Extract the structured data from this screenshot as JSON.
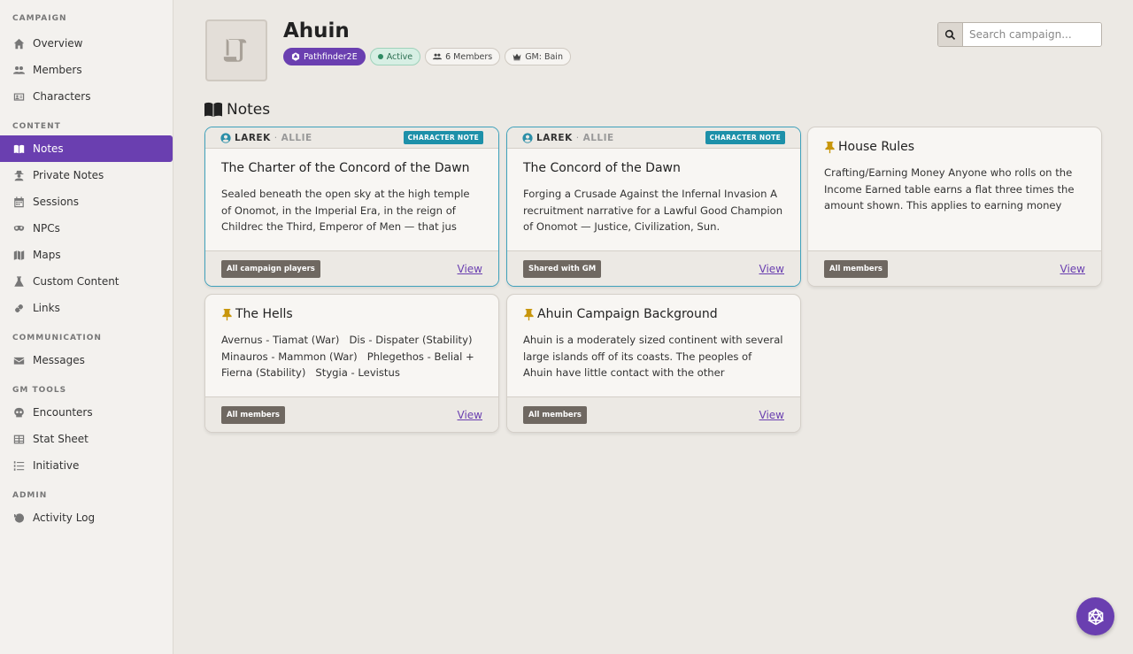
{
  "sidebar": {
    "sections": [
      {
        "label": "CAMPAIGN",
        "items": [
          {
            "label": "Overview",
            "icon": "home-icon"
          },
          {
            "label": "Members",
            "icon": "users-icon"
          },
          {
            "label": "Characters",
            "icon": "id-card-icon"
          }
        ]
      },
      {
        "label": "CONTENT",
        "items": [
          {
            "label": "Notes",
            "icon": "book-icon",
            "active": true
          },
          {
            "label": "Private Notes",
            "icon": "user-secret-icon"
          },
          {
            "label": "Sessions",
            "icon": "calendar-icon"
          },
          {
            "label": "NPCs",
            "icon": "mask-icon"
          },
          {
            "label": "Maps",
            "icon": "map-icon"
          },
          {
            "label": "Custom Content",
            "icon": "flask-icon"
          },
          {
            "label": "Links",
            "icon": "link-icon"
          }
        ]
      },
      {
        "label": "COMMUNICATION",
        "items": [
          {
            "label": "Messages",
            "icon": "envelope-icon"
          }
        ]
      },
      {
        "label": "GM TOOLS",
        "items": [
          {
            "label": "Encounters",
            "icon": "skull-icon"
          },
          {
            "label": "Stat Sheet",
            "icon": "table-icon"
          },
          {
            "label": "Initiative",
            "icon": "list-ordered-icon"
          }
        ]
      },
      {
        "label": "ADMIN",
        "items": [
          {
            "label": "Activity Log",
            "icon": "history-icon"
          }
        ]
      }
    ]
  },
  "campaign": {
    "title": "Ahuin",
    "system": "Pathfinder2E",
    "status": "Active",
    "members": "6 Members",
    "gm": "GM: Bain"
  },
  "search": {
    "placeholder": "Search campaign..."
  },
  "notes_heading": "Notes",
  "notes": [
    {
      "type": "character",
      "owner": "LAREK",
      "player": "ALLIE",
      "tag": "CHARACTER NOTE",
      "title": "The Charter of the Concord of the Dawn",
      "text": "Sealed beneath the open sky at the high temple of Onomot, in the Imperial Era, in the reign of Childrec the Third, Emperor of Men — that jus",
      "visibility": "All campaign players",
      "view": "View"
    },
    {
      "type": "character",
      "owner": "LAREK",
      "player": "ALLIE",
      "tag": "CHARACTER NOTE",
      "title": "The Concord of the Dawn",
      "text": "Forging a Crusade Against the Infernal Invasion A recruitment narrative for a Lawful Good Champion of Onomot — Justice, Civilization, Sun.",
      "visibility": "Shared with GM",
      "view": "View"
    },
    {
      "type": "pinned",
      "title": "House Rules",
      "text": "Crafting/Earning Money Anyone who rolls on the Income Earned table earns a flat three times the amount shown. This applies to earning money",
      "visibility": "All members",
      "view": "View"
    },
    {
      "type": "pinned",
      "title": "The Hells",
      "text": "Avernus - Tiamat (War)   Dis - Dispater (Stability) Minauros - Mammon (War)   Phlegethos - Belial + Fierna (Stability)   Stygia - Levistus",
      "visibility": "All members",
      "view": "View"
    },
    {
      "type": "pinned",
      "title": "Ahuin Campaign Background",
      "text": "Ahuin is a moderately sized continent with several large islands off of its coasts. The peoples of Ahuin have little contact with the other",
      "visibility": "All members",
      "view": "View"
    }
  ],
  "colors": {
    "accent": "#6a3fb0",
    "character_border": "#3fa1bb",
    "pin": "#c8960c"
  }
}
